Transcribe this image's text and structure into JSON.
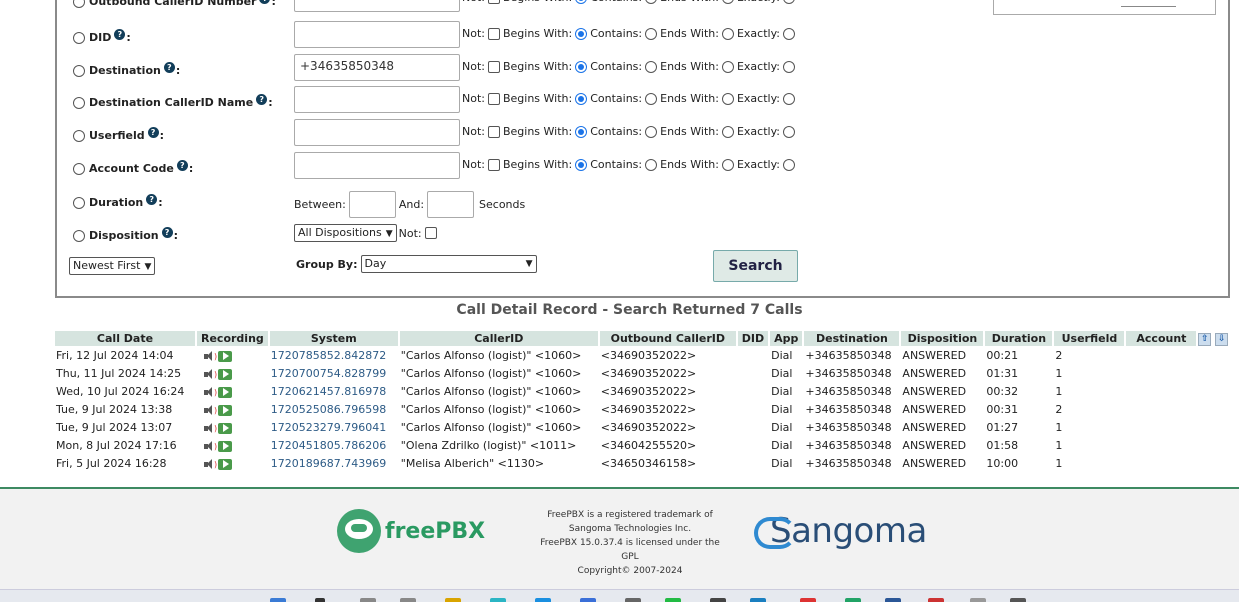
{
  "filters": [
    {
      "label": "Outbound CallerID Number",
      "value": "",
      "not": "Not:",
      "begins": "Begins With:",
      "contains": "Contains:",
      "ends": "Ends With:",
      "exactly": "Exactly:"
    },
    {
      "label": "DID",
      "value": "",
      "not": "Not:",
      "begins": "Begins With:",
      "contains": "Contains:",
      "ends": "Ends With:",
      "exactly": "Exactly:"
    },
    {
      "label": "Destination",
      "value": "+34635850348",
      "not": "Not:",
      "begins": "Begins With:",
      "contains": "Contains:",
      "ends": "Ends With:",
      "exactly": "Exactly:"
    },
    {
      "label": "Destination CallerID Name",
      "value": "",
      "not": "Not:",
      "begins": "Begins With:",
      "contains": "Contains:",
      "ends": "Ends With:",
      "exactly": "Exactly:"
    },
    {
      "label": "Userfield",
      "value": "",
      "not": "Not:",
      "begins": "Begins With:",
      "contains": "Contains:",
      "ends": "Ends With:",
      "exactly": "Exactly:"
    },
    {
      "label": "Account Code",
      "value": "",
      "not": "Not:",
      "begins": "Begins With:",
      "contains": "Contains:",
      "ends": "Ends With:",
      "exactly": "Exactly:"
    }
  ],
  "duration": {
    "label": "Duration",
    "between": "Between:",
    "and": "And:",
    "seconds": "Seconds"
  },
  "disposition": {
    "label": "Disposition",
    "selected": "All Dispositions",
    "not": "Not:"
  },
  "order": {
    "selected": "Newest First"
  },
  "groupby": {
    "label": "Group By:",
    "selected": "Day"
  },
  "search_label": "Search",
  "cdr_title": "Call Detail Record - Search Returned 7 Calls",
  "columns": [
    "Call Date",
    "Recording",
    "System",
    "CallerID",
    "Outbound CallerID",
    "DID",
    "App",
    "Destination",
    "Disposition",
    "Duration",
    "Userfield",
    "Account"
  ],
  "rows": [
    {
      "date": "Fri, 12 Jul 2024 14:04",
      "system": "1720785852.842872",
      "callerid": "\"Carlos Alfonso (logist)\" <1060>",
      "outbound": "<34690352022>",
      "did": "",
      "app": "Dial",
      "dest": "+34635850348",
      "disp": "ANSWERED",
      "dur": "00:21",
      "userfield": "2",
      "account": ""
    },
    {
      "date": "Thu, 11 Jul 2024 14:25",
      "system": "1720700754.828799",
      "callerid": "\"Carlos Alfonso (logist)\" <1060>",
      "outbound": "<34690352022>",
      "did": "",
      "app": "Dial",
      "dest": "+34635850348",
      "disp": "ANSWERED",
      "dur": "01:31",
      "userfield": "1",
      "account": ""
    },
    {
      "date": "Wed, 10 Jul 2024 16:24",
      "system": "1720621457.816978",
      "callerid": "\"Carlos Alfonso (logist)\" <1060>",
      "outbound": "<34690352022>",
      "did": "",
      "app": "Dial",
      "dest": "+34635850348",
      "disp": "ANSWERED",
      "dur": "00:32",
      "userfield": "1",
      "account": ""
    },
    {
      "date": "Tue, 9 Jul 2024 13:38",
      "system": "1720525086.796598",
      "callerid": "\"Carlos Alfonso (logist)\" <1060>",
      "outbound": "<34690352022>",
      "did": "",
      "app": "Dial",
      "dest": "+34635850348",
      "disp": "ANSWERED",
      "dur": "00:31",
      "userfield": "2",
      "account": ""
    },
    {
      "date": "Tue, 9 Jul 2024 13:07",
      "system": "1720523279.796041",
      "callerid": "\"Carlos Alfonso (logist)\" <1060>",
      "outbound": "<34690352022>",
      "did": "",
      "app": "Dial",
      "dest": "+34635850348",
      "disp": "ANSWERED",
      "dur": "01:27",
      "userfield": "1",
      "account": ""
    },
    {
      "date": "Mon, 8 Jul 2024 17:16",
      "system": "1720451805.786206",
      "callerid": "\"Olena Zdrilko (logist)\" <1011>",
      "outbound": "<34604255520>",
      "did": "",
      "app": "Dial",
      "dest": "+34635850348",
      "disp": "ANSWERED",
      "dur": "01:58",
      "userfield": "1",
      "account": ""
    },
    {
      "date": "Fri, 5 Jul 2024 16:28",
      "system": "1720189687.743969",
      "callerid": "\"Melisa Alberich\" <1130>",
      "outbound": "<34650346158>",
      "did": "",
      "app": "Dial",
      "dest": "+34635850348",
      "disp": "ANSWERED",
      "dur": "10:00",
      "userfield": "1",
      "account": ""
    }
  ],
  "footer": {
    "freepbx_logo": "freePBX",
    "legal": [
      "FreePBX is a registered trademark of",
      "Sangoma Technologies Inc.",
      "FreePBX 15.0.37.4 is licensed under the",
      "GPL",
      "Copyright© 2007-2024"
    ],
    "sangoma_logo": "Sangoma"
  },
  "colors": {
    "header_bg": "#d6e4df",
    "footer_bar": "#3d8a62",
    "link": "#2d5b86"
  }
}
